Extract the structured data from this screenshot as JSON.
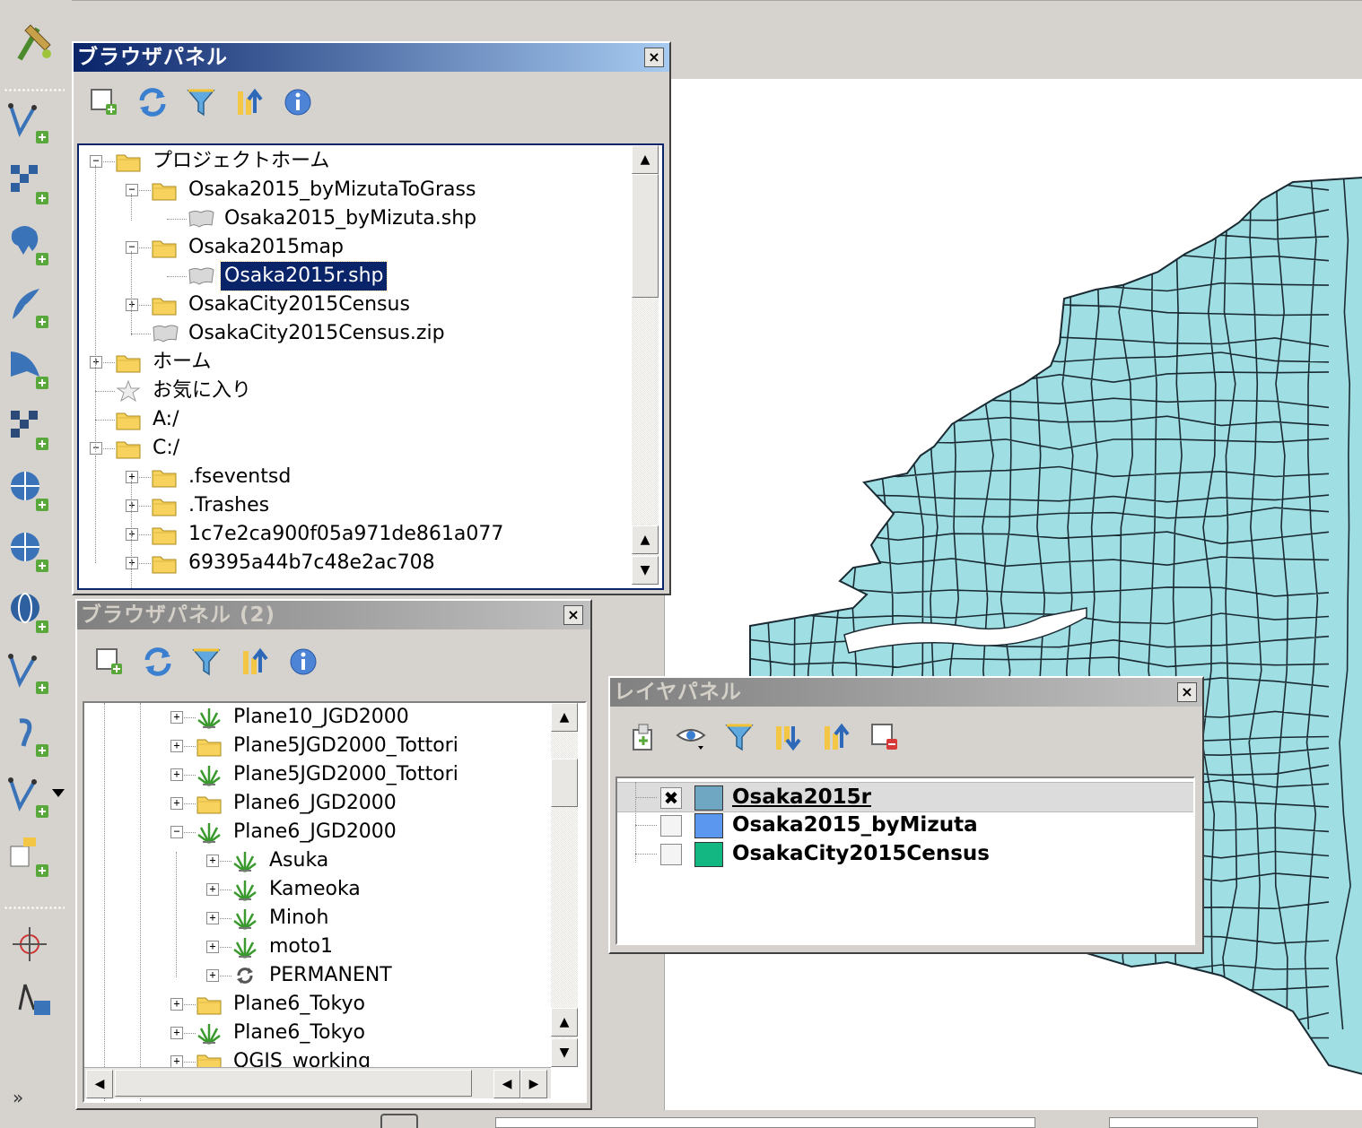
{
  "browser_panel": {
    "title": "ブラウザパネル",
    "close": "×",
    "toolbar": [
      "add-layer-icon",
      "refresh-icon",
      "filter-icon",
      "collapse-all-icon",
      "info-icon"
    ],
    "tree": [
      {
        "label": "プロジェクトホーム",
        "level": 0,
        "exp": "−",
        "icon": "folder"
      },
      {
        "label": "Osaka2015_byMizutaToGrass",
        "level": 1,
        "exp": "−",
        "icon": "folder"
      },
      {
        "label": "Osaka2015_byMizuta.shp",
        "level": 2,
        "exp": "",
        "icon": "shape"
      },
      {
        "label": "Osaka2015map",
        "level": 1,
        "exp": "−",
        "icon": "folder"
      },
      {
        "label": "Osaka2015r.shp",
        "level": 2,
        "exp": "",
        "icon": "shape",
        "selected": true
      },
      {
        "label": "OsakaCity2015Census",
        "level": 1,
        "exp": "+",
        "icon": "folder"
      },
      {
        "label": "OsakaCity2015Census.zip",
        "level": 1,
        "exp": "",
        "icon": "shape"
      },
      {
        "label": "ホーム",
        "level": 0,
        "exp": "+",
        "icon": "folder"
      },
      {
        "label": "お気に入り",
        "level": 0,
        "exp": "",
        "icon": "star"
      },
      {
        "label": "A:/",
        "level": 0,
        "exp": "",
        "icon": "folder"
      },
      {
        "label": "C:/",
        "level": 0,
        "exp": "−",
        "icon": "folder"
      },
      {
        "label": ".fseventsd",
        "level": 1,
        "exp": "+",
        "icon": "folder"
      },
      {
        "label": ".Trashes",
        "level": 1,
        "exp": "+",
        "icon": "folder"
      },
      {
        "label": "1c7e2ca900f05a971de861a077",
        "level": 1,
        "exp": "+",
        "icon": "folder"
      },
      {
        "label": "69395a44b7c48e2ac708",
        "level": 1,
        "exp": "+",
        "icon": "folder"
      }
    ]
  },
  "browser_panel_2": {
    "title": "ブラウザパネル (2)",
    "close": "×",
    "toolbar": [
      "add-layer-icon",
      "refresh-icon",
      "filter-icon",
      "collapse-all-icon",
      "info-icon"
    ],
    "tree": [
      {
        "label": "Plane10_JGD2000",
        "level": 1,
        "exp": "+",
        "icon": "grass"
      },
      {
        "label": "Plane5JGD2000_Tottori",
        "level": 1,
        "exp": "+",
        "icon": "folder"
      },
      {
        "label": "Plane5JGD2000_Tottori",
        "level": 1,
        "exp": "+",
        "icon": "grass"
      },
      {
        "label": "Plane6_JGD2000",
        "level": 1,
        "exp": "+",
        "icon": "folder"
      },
      {
        "label": "Plane6_JGD2000",
        "level": 1,
        "exp": "−",
        "icon": "grass"
      },
      {
        "label": "Asuka",
        "level": 2,
        "exp": "+",
        "icon": "grass"
      },
      {
        "label": "Kameoka",
        "level": 2,
        "exp": "+",
        "icon": "grass"
      },
      {
        "label": "Minoh",
        "level": 2,
        "exp": "+",
        "icon": "grass"
      },
      {
        "label": "moto1",
        "level": 2,
        "exp": "+",
        "icon": "grass"
      },
      {
        "label": "PERMANENT",
        "level": 2,
        "exp": "+",
        "icon": "cycle"
      },
      {
        "label": "Plane6_Tokyo",
        "level": 1,
        "exp": "+",
        "icon": "folder"
      },
      {
        "label": "Plane6_Tokyo",
        "level": 1,
        "exp": "+",
        "icon": "grass"
      },
      {
        "label": "QGIS_working",
        "level": 1,
        "exp": "+",
        "icon": "folder"
      }
    ]
  },
  "layer_panel": {
    "title": "レイヤパネル",
    "close": "×",
    "toolbar": [
      "add-group-icon",
      "visibility-icon",
      "filter-icon",
      "expand-all-icon",
      "collapse-all-icon",
      "remove-layer-icon"
    ],
    "layers": [
      {
        "name": "Osaka2015r",
        "checked": true,
        "color": "#6fa7c3",
        "current": true
      },
      {
        "name": "Osaka2015_byMizuta",
        "checked": false,
        "color": "#5b97ef",
        "current": false
      },
      {
        "name": "OsakaCity2015Census",
        "checked": false,
        "color": "#12b782",
        "current": false
      }
    ],
    "check_mark": "✖"
  },
  "left_toolbar": [
    "add-vector-layer-icon",
    "add-raster-layer-icon",
    "add-postgis-layer-icon",
    "add-spatialite-layer-icon",
    "add-mssql-layer-icon",
    "add-db2-layer-icon",
    "add-oracle-layer-icon",
    "add-wms-layer-icon",
    "add-wcs-layer-icon",
    "add-wfs-layer-icon",
    "add-delimited-text-icon",
    "new-shapefile-icon",
    "add-virtual-layer-icon",
    "gps-icon",
    "measure-icon"
  ],
  "map": {
    "fill": "#9fdfe3",
    "stroke": "#1a2a33"
  }
}
